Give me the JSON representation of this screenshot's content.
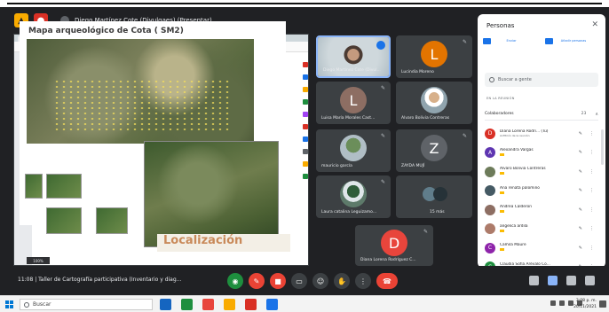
{
  "meeting": {
    "presenter_label": "Diego Martínez Cote (Divulgaes) (Presentar)",
    "info": "11:08  |  Taller de Cartografía participativa (Inventario y diag..."
  },
  "document": {
    "tabs": [
      "Inicio",
      "Herramientas",
      "PRESENTACIÓN CARTO..."
    ],
    "slide_title": "Mapa arqueológico de Cota ( SM2)",
    "banner": "Localización",
    "zoom": "100%"
  },
  "tiles": [
    {
      "name": "Diego Martínez Cote (Divul...",
      "type": "camera"
    },
    {
      "name": "Lucindia Moreno",
      "type": "avatar",
      "letter": "L",
      "color": "#e37400"
    },
    {
      "name": "Luisa María Morales Cast...",
      "type": "avatar",
      "letter": "L",
      "color": "#8d6e63"
    },
    {
      "name": "Alvaro Bolivia Contreras",
      "type": "photo"
    },
    {
      "name": "mauricio garcía",
      "type": "photo"
    },
    {
      "name": "ZAYDA MUJÍ",
      "type": "avatar",
      "letter": "Z",
      "color": "#5f6368"
    },
    {
      "name": "Laura catalina Leguizamo...",
      "type": "photo"
    },
    {
      "name": "15 más",
      "type": "group"
    },
    {
      "name": "Diana Lorena Rodríguez C...",
      "type": "avatar",
      "letter": "D",
      "color": "#e8453c"
    }
  ],
  "people": {
    "title": "Personas",
    "actions": [
      "Enviar",
      "Añadir personas"
    ],
    "search_placeholder": "Buscar a gente",
    "section": "EN LA REUNIÓN",
    "collab_label": "Colaboradores",
    "collab_count": "23",
    "list": [
      {
        "name": "Diana Lorena Rodri... (Tú)",
        "sub": "Anfitrión de la reunión",
        "letter": "D",
        "color": "#d93025"
      },
      {
        "name": "Alexandra Vargas",
        "sub": "",
        "letter": "A",
        "color": "#5e35b1"
      },
      {
        "name": "Alvaro Bolivia Contreras",
        "sub": "",
        "letter": "",
        "color": "#6d7b5a"
      },
      {
        "name": "Ana renata palomino",
        "sub": "",
        "letter": "",
        "color": "#455a64"
      },
      {
        "name": "Andrea Calderon",
        "sub": "",
        "letter": "",
        "color": "#8d6e63"
      },
      {
        "name": "angelica ardila",
        "sub": "",
        "letter": "",
        "color": "#ad7b6a"
      },
      {
        "name": "Camila Maure",
        "sub": "",
        "letter": "C",
        "color": "#8e24aa"
      },
      {
        "name": "Claudia Sofía Arévalo Co...",
        "sub": "",
        "letter": "C",
        "color": "#1e8e3e"
      }
    ]
  },
  "taskbar": {
    "search_placeholder": "Buscar",
    "time": "3:08 p. m.",
    "date": "20/11/2021"
  }
}
